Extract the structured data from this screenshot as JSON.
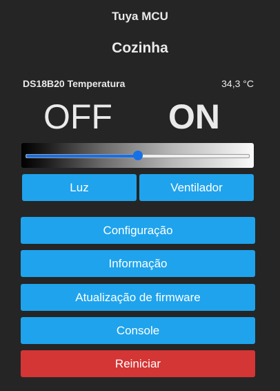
{
  "app": {
    "title": "Tuya MCU"
  },
  "device": {
    "name": "Cozinha"
  },
  "sensor": {
    "label": "DS18B20 Temperatura",
    "value": "34,3 °C"
  },
  "states": {
    "off_label": "OFF",
    "on_label": "ON"
  },
  "slider": {
    "level": 0.5,
    "fill_color": "#1670e8"
  },
  "toggles": [
    {
      "label": "Luz"
    },
    {
      "label": "Ventilador"
    }
  ],
  "menu": {
    "config": "Configuração",
    "info": "Informação",
    "firmware": "Atualização de firmware",
    "console": "Console",
    "restart": "Reiniciar"
  },
  "colors": {
    "button": "#1fa3ec",
    "danger": "#d43535",
    "background": "#252525"
  }
}
